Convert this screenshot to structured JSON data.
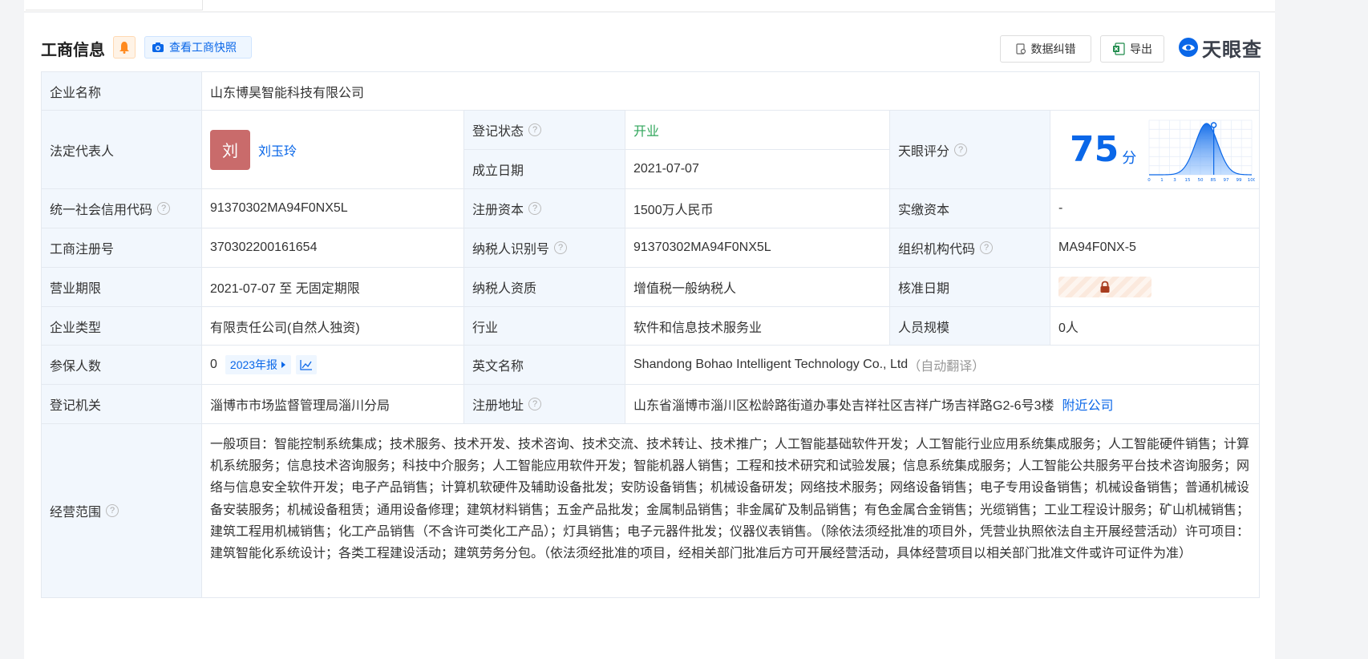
{
  "header": {
    "title": "工商信息",
    "snapshot_label": "查看工商快照",
    "correct_label": "数据纠错",
    "export_label": "导出",
    "logo_text": "天眼查"
  },
  "rows": {
    "company_name_label": "企业名称",
    "company_name": "山东博昊智能科技有限公司",
    "legal_rep_label": "法定代表人",
    "legal_rep_avatar": "刘",
    "legal_rep_name": "刘玉玲",
    "reg_status_label": "登记状态",
    "reg_status": "开业",
    "found_date_label": "成立日期",
    "found_date": "2021-07-07",
    "tianyan_score_label": "天眼评分",
    "tianyan_score": "75",
    "score_unit": "分",
    "credit_code_label": "统一社会信用代码",
    "credit_code": "91370302MA94F0NX5L",
    "reg_capital_label": "注册资本",
    "reg_capital": "1500万人民币",
    "paid_capital_label": "实缴资本",
    "paid_capital": "-",
    "biz_reg_no_label": "工商注册号",
    "biz_reg_no": "370302200161654",
    "taxpayer_id_label": "纳税人识别号",
    "taxpayer_id": "91370302MA94F0NX5L",
    "org_code_label": "组织机构代码",
    "org_code": "MA94F0NX-5",
    "op_period_label": "营业期限",
    "op_period": "2021-07-07 至 无固定期限",
    "taxpayer_qual_label": "纳税人资质",
    "taxpayer_qual": "增值税一般纳税人",
    "approve_date_label": "核准日期",
    "company_type_label": "企业类型",
    "company_type": "有限责任公司(自然人独资)",
    "industry_label": "行业",
    "industry": "软件和信息技术服务业",
    "staff_size_label": "人员规模",
    "staff_size": "0人",
    "insured_label": "参保人数",
    "insured": "0",
    "report_tag": "2023年报",
    "english_name_label": "英文名称",
    "english_name": "Shandong Bohao Intelligent Technology Co., Ltd",
    "auto_translate": "（自动翻译）",
    "reg_authority_label": "登记机关",
    "reg_authority": "淄博市市场监督管理局淄川分局",
    "reg_address_label": "注册地址",
    "reg_address": "山东省淄博市淄川区松龄路街道办事处吉祥社区吉祥广场吉祥路G2-6号3楼",
    "nearby_link": "附近公司",
    "scope_label": "经营范围",
    "scope": "一般项目：智能控制系统集成；技术服务、技术开发、技术咨询、技术交流、技术转让、技术推广；人工智能基础软件开发；人工智能行业应用系统集成服务；人工智能硬件销售；计算机系统服务；信息技术咨询服务；科技中介服务；人工智能应用软件开发；智能机器人销售；工程和技术研究和试验发展；信息系统集成服务；人工智能公共服务平台技术咨询服务；网络与信息安全软件开发；电子产品销售；计算机软硬件及辅助设备批发；安防设备销售；机械设备研发；网络技术服务；网络设备销售；电子专用设备销售；机械设备销售；普通机械设备安装服务；机械设备租赁；通用设备修理；建筑材料销售；五金产品批发；金属制品销售；非金属矿及制品销售；有色金属合金销售；光缆销售；工业工程设计服务；矿山机械销售；建筑工程用机械销售；化工产品销售（不含许可类化工产品）；灯具销售；电子元器件批发；仪器仪表销售。（除依法须经批准的项目外，凭营业执照依法自主开展经营活动）许可项目：建筑智能化系统设计；各类工程建设活动；建筑劳务分包。（依法须经批准的项目，经相关部门批准后方可开展经营活动，具体经营项目以相关部门批准文件或许可证件为准）"
  },
  "score_chart": {
    "x_ticks": [
      "0",
      "1",
      "3",
      "15",
      "50",
      "85",
      "97",
      "99",
      "100"
    ],
    "marker_position": 75
  },
  "colors": {
    "accent": "#0a67e8",
    "status_green": "#2fa55a",
    "label_bg": "#f2f7fd",
    "avatar_bg": "#c96b6b"
  }
}
